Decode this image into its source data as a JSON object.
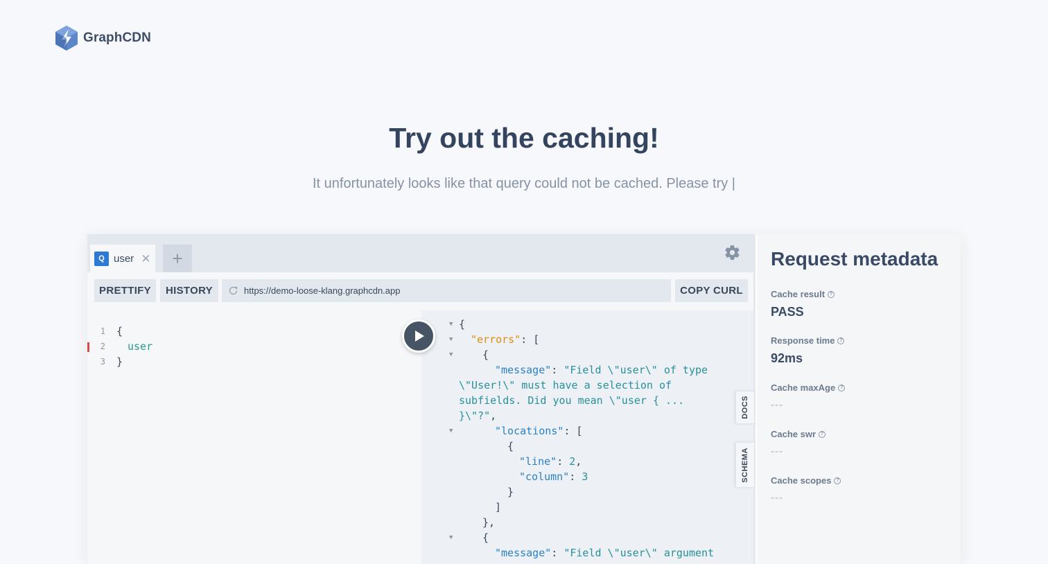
{
  "header": {
    "brand": "GraphCDN"
  },
  "hero": {
    "title": "Try out the caching!",
    "subtitle": "It unfortunately looks like that query could not be cached. Please try |"
  },
  "playground": {
    "tabs": [
      {
        "badge": "Q",
        "label": "user",
        "close": "✕"
      }
    ],
    "add_tab": "+",
    "toolbar": {
      "prettify": "PRETTIFY",
      "history": "HISTORY",
      "copy_curl": "COPY CURL"
    },
    "endpoint_url": "https://demo-loose-klang.graphcdn.app",
    "editor": {
      "lines": [
        {
          "n": "1",
          "text": "{"
        },
        {
          "n": "2",
          "text": "user"
        },
        {
          "n": "3",
          "text": "}"
        }
      ]
    },
    "result": {
      "l1": "{",
      "l2_key": "\"errors\"",
      "l2_rest": ": [",
      "l3": "{",
      "l4_key": "\"message\"",
      "l4_rest": ": ",
      "l4_val": "\"Field \\\"user\\\" of type",
      "l5": "\\\"User!\\\" must have a selection of",
      "l6": "subfields. Did you mean \\\"user { ...",
      "l7": "}\\\"?\"",
      "l7_rest": ",",
      "l8_key": "\"locations\"",
      "l8_rest": ": [",
      "l9": "{",
      "l10_key": "\"line\"",
      "l10_rest": ": ",
      "l10_val": "2",
      "l10_end": ",",
      "l11_key": "\"column\"",
      "l11_rest": ": ",
      "l11_val": "3",
      "l12": "}",
      "l13": "]",
      "l14": "},",
      "l15": "{",
      "l16_key": "\"message\"",
      "l16_rest": ": ",
      "l16_val": "\"Field \\\"user\\\" argument"
    },
    "side_tabs": {
      "docs": "DOCS",
      "schema": "SCHEMA"
    }
  },
  "metadata": {
    "title": "Request metadata",
    "help_glyph": "?",
    "items": [
      {
        "label": "Cache result",
        "value": "PASS"
      },
      {
        "label": "Response time",
        "value": "92ms"
      },
      {
        "label": "Cache maxAge",
        "value": "---"
      },
      {
        "label": "Cache swr",
        "value": "---"
      },
      {
        "label": "Cache scopes",
        "value": "---"
      }
    ]
  },
  "colors": {
    "accent": "#2d7ad6",
    "error": "#e04848",
    "key_orange": "#e08d10",
    "key_blue": "#2a82c6",
    "value": "#27909a"
  }
}
